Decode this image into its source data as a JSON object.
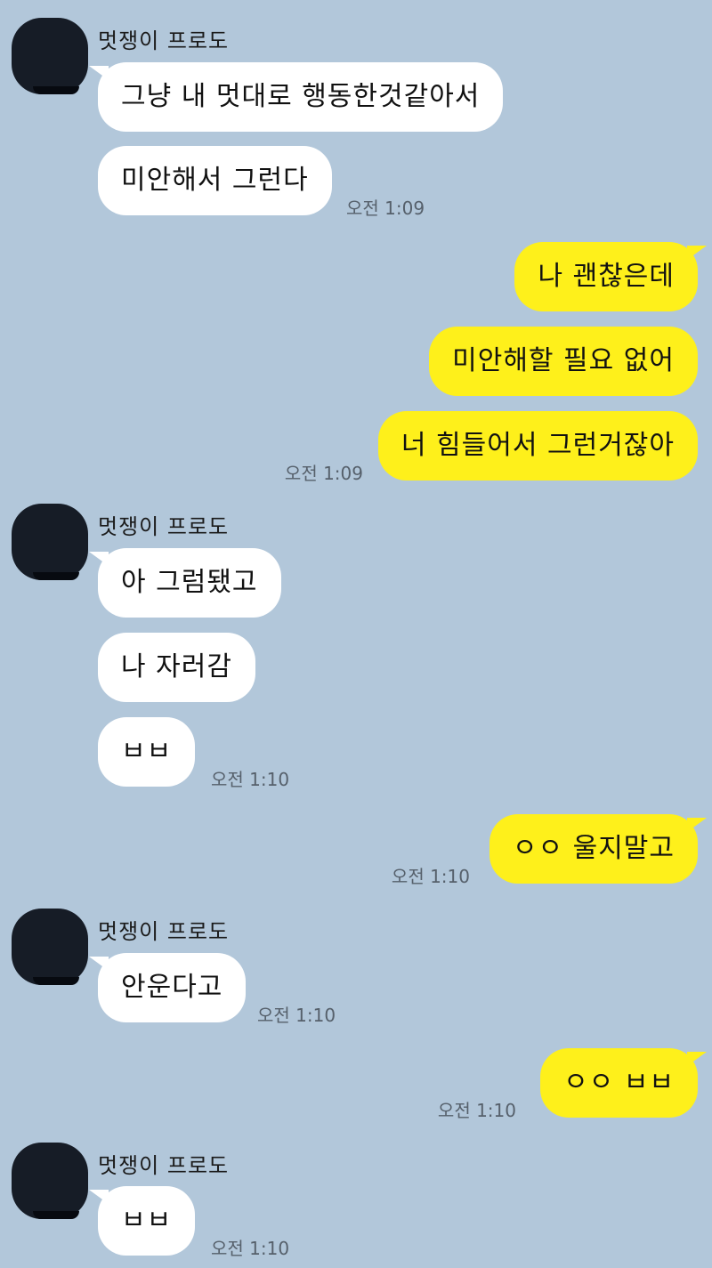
{
  "chat": {
    "messages": [
      {
        "sender": "멋쟁이 프로도",
        "text": "그냥 내 멋대로 행동한것같아서"
      },
      {
        "text": "미안해서 그런다",
        "time": "오전 1:09"
      },
      {
        "text": "나 괜찮은데"
      },
      {
        "text": "미안해할 필요 없어"
      },
      {
        "text": "너 힘들어서 그런거잖아",
        "time": "오전 1:09"
      },
      {
        "sender": "멋쟁이 프로도",
        "text": "아 그럼됐고"
      },
      {
        "text": "나 자러감"
      },
      {
        "text": "ㅂㅂ",
        "time": "오전 1:10"
      },
      {
        "text": "ㅇㅇ 울지말고",
        "time": "오전 1:10"
      },
      {
        "sender": "멋쟁이 프로도",
        "text": "안운다고",
        "time": "오전 1:10"
      },
      {
        "text": "ㅇㅇ ㅂㅂ",
        "time": "오전 1:10"
      },
      {
        "sender": "멋쟁이 프로도",
        "text": "ㅂㅂ",
        "time": "오전 1:10"
      }
    ]
  },
  "colors": {
    "background": "#b2c7da",
    "incoming_bubble": "#ffffff",
    "outgoing_bubble": "#fef01b",
    "avatar": "#161c26"
  }
}
